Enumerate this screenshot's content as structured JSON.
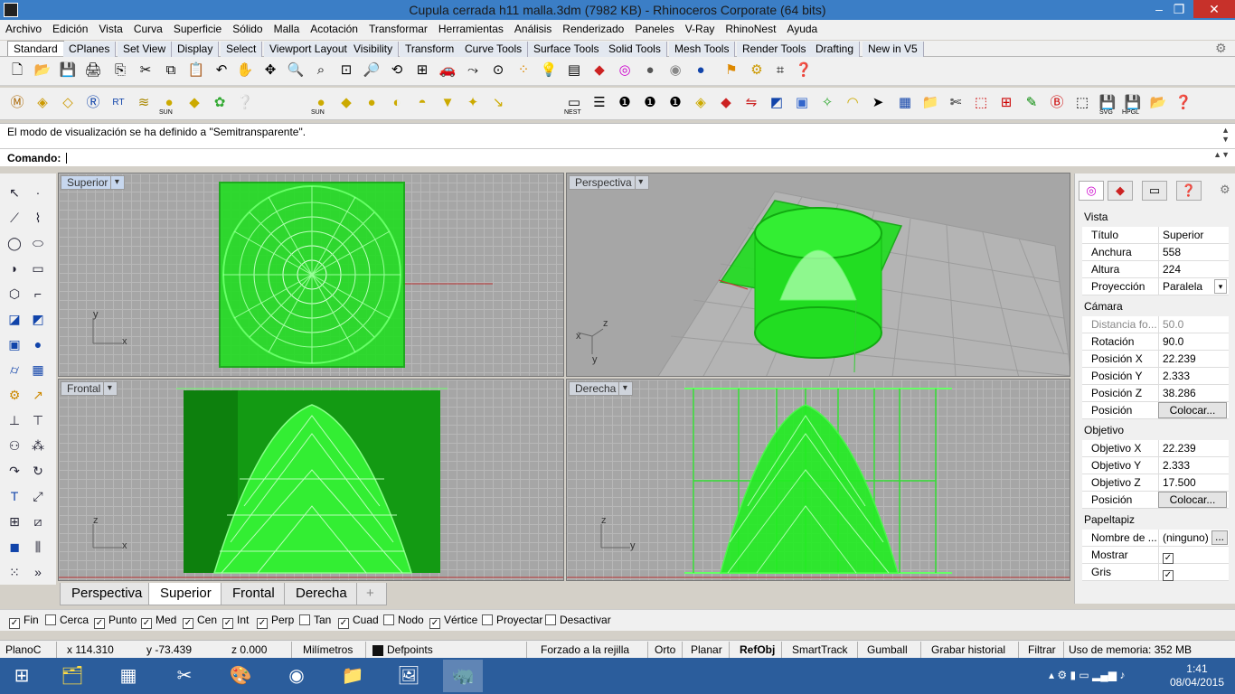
{
  "window": {
    "title": "Cupula cerrada h11 malla.3dm (7982 KB) - Rhinoceros Corporate (64 bits)",
    "minimize": "–",
    "restore": "❐",
    "close": "✕"
  },
  "menu": [
    "Archivo",
    "Edición",
    "Vista",
    "Curva",
    "Superficie",
    "Sólido",
    "Malla",
    "Acotación",
    "Transformar",
    "Herramientas",
    "Análisis",
    "Renderizado",
    "Paneles",
    "V-Ray",
    "RhinoNest",
    "Ayuda"
  ],
  "toolbar_tabs": [
    "Standard",
    "CPlanes",
    "Set View",
    "Display",
    "Select",
    "Viewport Layout",
    "Visibility",
    "Transform",
    "Curve Tools",
    "Surface Tools",
    "Solid Tools",
    "Mesh Tools",
    "Render Tools",
    "Drafting",
    "New in V5"
  ],
  "toolbar2_labels": {
    "sun1": "SUN",
    "sun2": "SUN",
    "nest": "NEST",
    "svg": "SVG",
    "hpgl": "HPGL"
  },
  "command": {
    "history": "El modo de visualización se ha definido a \"Semitransparente\".",
    "prompt_label": "Comando:",
    "value": ""
  },
  "viewports": {
    "superior": {
      "title": "Superior",
      "axis_x": "x",
      "axis_y": "y"
    },
    "perspectiva": {
      "title": "Perspectiva",
      "axis_x": "x",
      "axis_y": "y",
      "axis_z": "z"
    },
    "frontal": {
      "title": "Frontal",
      "axis_x": "x",
      "axis_z": "z"
    },
    "derecha": {
      "title": "Derecha",
      "axis_y": "y",
      "axis_z": "z"
    }
  },
  "viewport_tabs": [
    "Perspectiva",
    "Superior",
    "Frontal",
    "Derecha"
  ],
  "viewport_tab_add": "+",
  "active_viewport_tab": "Superior",
  "snaps": [
    {
      "label": "Fin",
      "checked": true
    },
    {
      "label": "Cerca",
      "checked": false
    },
    {
      "label": "Punto",
      "checked": true
    },
    {
      "label": "Med",
      "checked": true
    },
    {
      "label": "Cen",
      "checked": true
    },
    {
      "label": "Int",
      "checked": true
    },
    {
      "label": "Perp",
      "checked": true
    },
    {
      "label": "Tan",
      "checked": false
    },
    {
      "label": "Cuad",
      "checked": true
    },
    {
      "label": "Nodo",
      "checked": false
    },
    {
      "label": "Vértice",
      "checked": true
    },
    {
      "label": "Proyectar",
      "checked": false
    },
    {
      "label": "Desactivar",
      "checked": false
    }
  ],
  "status": {
    "cplane": "PlanoC",
    "x": "x 114.310",
    "y": "y -73.439",
    "z": "z 0.000",
    "units": "Milímetros",
    "layer": "Defpoints",
    "grid_snap": "Forzado a la rejilla",
    "ortho": "Orto",
    "planar": "Planar",
    "osnap": "RefObj",
    "smarttrack": "SmartTrack",
    "gumball": "Gumball",
    "history": "Grabar historial",
    "filter": "Filtrar",
    "memory": "Uso de memoria: 352 MB"
  },
  "properties": {
    "vista_header": "Vista",
    "titulo": {
      "k": "Título",
      "v": "Superior"
    },
    "anchura": {
      "k": "Anchura",
      "v": "558"
    },
    "altura": {
      "k": "Altura",
      "v": "224"
    },
    "proyeccion": {
      "k": "Proyección",
      "v": "Paralela"
    },
    "camara_header": "Cámara",
    "distancia": {
      "k": "Distancia fo...",
      "v": "50.0"
    },
    "rotacion": {
      "k": "Rotación",
      "v": "90.0"
    },
    "posx": {
      "k": "Posición X",
      "v": "22.239"
    },
    "posy": {
      "k": "Posición Y",
      "v": "2.333"
    },
    "posz": {
      "k": "Posición Z",
      "v": "38.286"
    },
    "posicion": {
      "k": "Posición",
      "btn": "Colocar..."
    },
    "objetivo_header": "Objetivo",
    "objx": {
      "k": "Objetivo X",
      "v": "22.239"
    },
    "objy": {
      "k": "Objetivo Y",
      "v": "2.333"
    },
    "objz": {
      "k": "Objetivo Z",
      "v": "17.500"
    },
    "objpos": {
      "k": "Posición",
      "btn": "Colocar..."
    },
    "papel_header": "Papeltapiz",
    "nombre": {
      "k": "Nombre de ...",
      "v": "(ninguno)",
      "btn": "..."
    },
    "mostrar": {
      "k": "Mostrar",
      "checked": true
    },
    "gris": {
      "k": "Gris",
      "checked": true
    }
  },
  "taskbar": {
    "time": "1:41",
    "date": "08/04/2015"
  },
  "colors": {
    "accent": "#3b7ec6",
    "mesh_green": "#22e822",
    "viewport_bg": "#a6a6a6",
    "taskbar": "#2b5d9c"
  }
}
